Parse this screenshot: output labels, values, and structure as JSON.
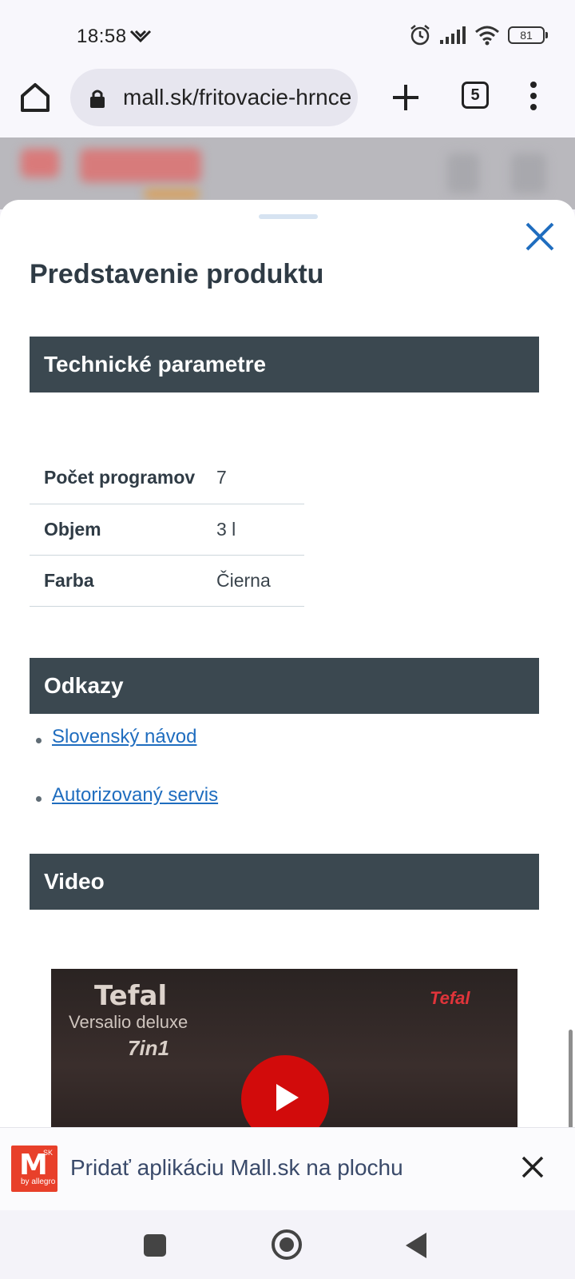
{
  "status_bar": {
    "time": "18:58",
    "battery": "81"
  },
  "browser": {
    "url": "mall.sk/fritovacie-hrnce",
    "tab_count": "5"
  },
  "sheet": {
    "title": "Predstavenie produktu",
    "sections": {
      "technical": "Technické parametre",
      "links": "Odkazy",
      "video": "Video"
    },
    "params": [
      {
        "key": "Počet programov",
        "value": "7"
      },
      {
        "key": "Objem",
        "value": "3 l"
      },
      {
        "key": "Farba",
        "value": "Čierna"
      }
    ],
    "links": [
      {
        "label": "Slovenský návod"
      },
      {
        "label": "Autorizovaný servis"
      }
    ],
    "video": {
      "brand": "Tefal",
      "product": "Versalio deluxe",
      "badge": "7in1",
      "logo": "Tefal"
    }
  },
  "install_banner": {
    "logo_letter": "M",
    "logo_sk": "SK",
    "logo_allegro": "by allegro",
    "text": "Pridať aplikáciu Mall.sk na plochu"
  },
  "colors": {
    "accent": "#1f6dbf",
    "section_bar": "#3b4850",
    "play_button": "#d20b0b",
    "brand": "#e8402a"
  },
  "icons": [
    "wifi-chevron-icon",
    "alarm-icon",
    "signal-icon",
    "wifi-icon",
    "battery-icon",
    "home-icon",
    "lock-icon",
    "plus-icon",
    "more-vert-icon",
    "close-icon",
    "play-icon"
  ]
}
